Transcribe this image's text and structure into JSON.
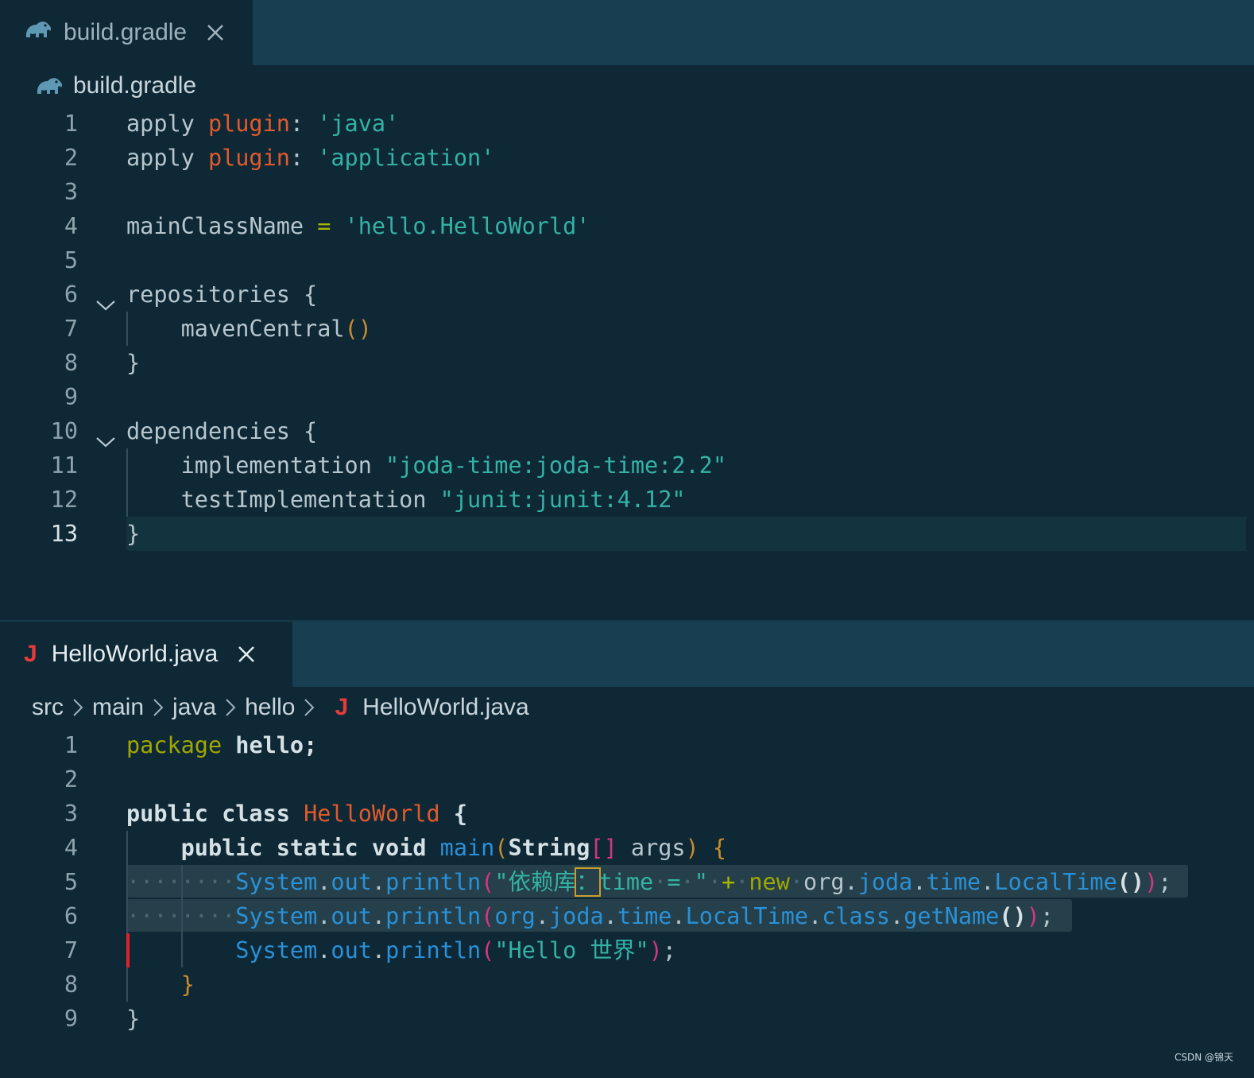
{
  "top_pane": {
    "tab": {
      "label": "build.gradle"
    },
    "breadcrumb": {
      "file": "build.gradle"
    },
    "lines": [
      {
        "n": "1",
        "tokens": [
          [
            "plain",
            "apply "
          ],
          [
            "kw",
            "plugin"
          ],
          [
            "plain",
            ": "
          ],
          [
            "str",
            "'java'"
          ]
        ]
      },
      {
        "n": "2",
        "tokens": [
          [
            "plain",
            "apply "
          ],
          [
            "kw",
            "plugin"
          ],
          [
            "plain",
            ": "
          ],
          [
            "str",
            "'application'"
          ]
        ]
      },
      {
        "n": "3",
        "tokens": []
      },
      {
        "n": "4",
        "tokens": [
          [
            "plain",
            "mainClassName "
          ],
          [
            "op",
            "="
          ],
          [
            "plain",
            " "
          ],
          [
            "str",
            "'hello.HelloWorld'"
          ]
        ]
      },
      {
        "n": "5",
        "tokens": []
      },
      {
        "n": "6",
        "fold": true,
        "tokens": [
          [
            "plain",
            "repositories {"
          ]
        ]
      },
      {
        "n": "7",
        "tokens": [
          [
            "plain",
            "    mavenCentral"
          ],
          [
            "paren",
            "()"
          ]
        ]
      },
      {
        "n": "8",
        "tokens": [
          [
            "plain",
            "}"
          ]
        ]
      },
      {
        "n": "9",
        "tokens": []
      },
      {
        "n": "10",
        "fold": true,
        "tokens": [
          [
            "plain",
            "dependencies {"
          ]
        ]
      },
      {
        "n": "11",
        "tokens": [
          [
            "plain",
            "    implementation "
          ],
          [
            "str",
            "\"joda-time:joda-time:2.2\""
          ]
        ]
      },
      {
        "n": "12",
        "tokens": [
          [
            "plain",
            "    testImplementation "
          ],
          [
            "str",
            "\"junit:junit:4.12\""
          ]
        ]
      },
      {
        "n": "13",
        "active": true,
        "tokens": [
          [
            "plain",
            "}"
          ]
        ]
      }
    ]
  },
  "bottom_pane": {
    "tab": {
      "label": "HelloWorld.java"
    },
    "breadcrumb": {
      "parts": [
        "src",
        "main",
        "java",
        "hello"
      ],
      "file": "HelloWorld.java"
    },
    "lines": [
      {
        "n": "1",
        "tokens": [
          [
            "pkg",
            "package"
          ],
          [
            "plain",
            " "
          ],
          [
            "bold",
            "hello;"
          ]
        ]
      },
      {
        "n": "2",
        "tokens": []
      },
      {
        "n": "3",
        "tokens": [
          [
            "bold",
            "public class "
          ],
          [
            "cls",
            "HelloWorld"
          ],
          [
            "plain",
            " "
          ],
          [
            "bold",
            "{"
          ]
        ]
      },
      {
        "n": "4",
        "tokens": [
          [
            "plain",
            "    "
          ],
          [
            "bold",
            "public static void "
          ],
          [
            "blue",
            "main"
          ],
          [
            "paren",
            "("
          ],
          [
            "bold",
            "String"
          ],
          [
            "pink",
            "[]"
          ],
          [
            "plain",
            " args"
          ],
          [
            "paren",
            ")"
          ],
          [
            "plain",
            " "
          ],
          [
            "paren",
            "{"
          ]
        ]
      },
      {
        "n": "5",
        "tokens": [
          [
            "ws",
            "····"
          ],
          [
            "ws",
            "····"
          ],
          [
            "blue",
            "System"
          ],
          [
            "plain",
            "."
          ],
          [
            "blue",
            "out"
          ],
          [
            "plain",
            "."
          ],
          [
            "blue",
            "println"
          ],
          [
            "pink",
            "("
          ],
          [
            "str",
            "\"依赖库"
          ],
          [
            "cursor",
            "："
          ],
          [
            "str",
            "time"
          ],
          [
            "ws",
            "·"
          ],
          [
            "str",
            "="
          ],
          [
            "ws",
            "·"
          ],
          [
            "str",
            "\""
          ],
          [
            "ws",
            "·"
          ],
          [
            "op",
            "+"
          ],
          [
            "ws",
            "·"
          ],
          [
            "pkg",
            "new"
          ],
          [
            "ws",
            "·"
          ],
          [
            "plain",
            "org"
          ],
          [
            "plain",
            "."
          ],
          [
            "blue",
            "joda"
          ],
          [
            "plain",
            "."
          ],
          [
            "blue",
            "time"
          ],
          [
            "plain",
            "."
          ],
          [
            "blue",
            "LocalTime"
          ],
          [
            "bold",
            "()"
          ],
          [
            "pink",
            ")"
          ],
          [
            "plain",
            ";"
          ]
        ]
      },
      {
        "n": "6",
        "tokens": [
          [
            "ws",
            "····"
          ],
          [
            "ws",
            "····"
          ],
          [
            "blue",
            "System"
          ],
          [
            "plain",
            "."
          ],
          [
            "blue",
            "out"
          ],
          [
            "plain",
            "."
          ],
          [
            "blue",
            "println"
          ],
          [
            "pink",
            "("
          ],
          [
            "blue",
            "org"
          ],
          [
            "plain",
            "."
          ],
          [
            "blue",
            "joda"
          ],
          [
            "plain",
            "."
          ],
          [
            "blue",
            "time"
          ],
          [
            "plain",
            "."
          ],
          [
            "blue",
            "LocalTime"
          ],
          [
            "plain",
            "."
          ],
          [
            "blue",
            "class"
          ],
          [
            "plain",
            "."
          ],
          [
            "blue",
            "getName"
          ],
          [
            "bold",
            "()"
          ],
          [
            "pink",
            ")"
          ],
          [
            "plain",
            ";"
          ]
        ]
      },
      {
        "n": "7",
        "tokens": [
          [
            "plain",
            "        "
          ],
          [
            "blue",
            "System"
          ],
          [
            "plain",
            "."
          ],
          [
            "blue",
            "out"
          ],
          [
            "plain",
            "."
          ],
          [
            "blue",
            "println"
          ],
          [
            "pink",
            "("
          ],
          [
            "str",
            "\"Hello 世界\""
          ],
          [
            "pink",
            ")"
          ],
          [
            "plain",
            ";"
          ]
        ]
      },
      {
        "n": "8",
        "tokens": [
          [
            "plain",
            "    "
          ],
          [
            "paren",
            "}"
          ]
        ]
      },
      {
        "n": "9",
        "tokens": [
          [
            "plain",
            "}"
          ]
        ]
      }
    ]
  },
  "watermark": "CSDN @锦天",
  "colors": {
    "editor_bg": "#0e2836",
    "tabbar_bg": "#173e51",
    "accent_red": "#e53b3b",
    "string": "#34b2a4",
    "keyword": "#e25a2c"
  }
}
